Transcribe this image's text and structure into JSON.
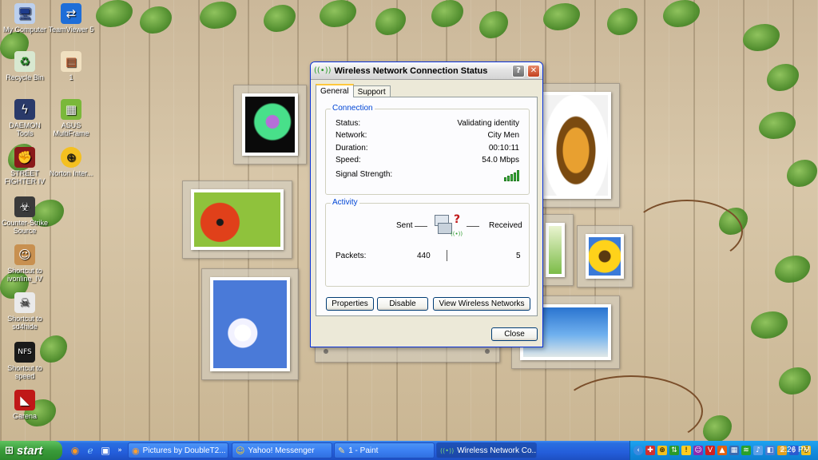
{
  "desktop": {
    "icons": [
      {
        "label": "My Computer",
        "icon": "computer-icon"
      },
      {
        "label": "TeamViewer 5",
        "icon": "teamviewer-icon"
      },
      {
        "label": "Recycle Bin",
        "icon": "recycle-bin-icon"
      },
      {
        "label": "1",
        "icon": "file-icon"
      },
      {
        "label": "DAEMON Tools",
        "icon": "daemon-tools-icon"
      },
      {
        "label": "ASUS MultiFrame",
        "icon": "asus-icon"
      },
      {
        "label": "STREET FIGHTER IV",
        "icon": "game-icon"
      },
      {
        "label": "Norton Inter...",
        "icon": "norton-icon"
      },
      {
        "label": "Counter-Strike Source",
        "icon": "counter-strike-icon"
      },
      {
        "label": "Shortcut to ivonline_IV",
        "icon": "shortcut-icon"
      },
      {
        "label": "Shortcut to sd4hide",
        "icon": "skull-icon"
      },
      {
        "label": "Shortcut to speed",
        "icon": "nfs-icon"
      },
      {
        "label": "Garena",
        "icon": "garena-icon"
      }
    ]
  },
  "dialog": {
    "title": "Wireless Network Connection Status",
    "tabs": [
      {
        "label": "General"
      },
      {
        "label": "Support"
      }
    ],
    "connection": {
      "group_label": "Connection",
      "status_label": "Status:",
      "status_value": "Validating identity",
      "network_label": "Network:",
      "network_value": "City Men",
      "duration_label": "Duration:",
      "duration_value": "00:10:11",
      "speed_label": "Speed:",
      "speed_value": "54.0 Mbps",
      "signal_label": "Signal Strength:",
      "signal_bars": 5
    },
    "activity": {
      "group_label": "Activity",
      "sent_label": "Sent",
      "received_label": "Received",
      "packets_label": "Packets:",
      "packets_sent": "440",
      "packets_received": "5"
    },
    "buttons": {
      "properties": "Properties",
      "disable": "Disable",
      "view_networks": "View Wireless Networks",
      "close": "Close"
    }
  },
  "taskbar": {
    "start_label": "start",
    "tasks": [
      {
        "label": "Pictures by DoubleT2...",
        "icon": "firefox-icon"
      },
      {
        "label": "Yahoo! Messenger",
        "icon": "yahoo-messenger-icon"
      },
      {
        "label": "1 - Paint",
        "icon": "paint-icon"
      },
      {
        "label": "Wireless Network Co...",
        "icon": "wireless-icon"
      }
    ],
    "clock": "2:26 PM"
  },
  "colors": {
    "taskbar_blue": "#245edb",
    "start_green": "#3a9b3a",
    "group_title_blue": "#0046d5",
    "signal_green": "#3fb33f"
  }
}
